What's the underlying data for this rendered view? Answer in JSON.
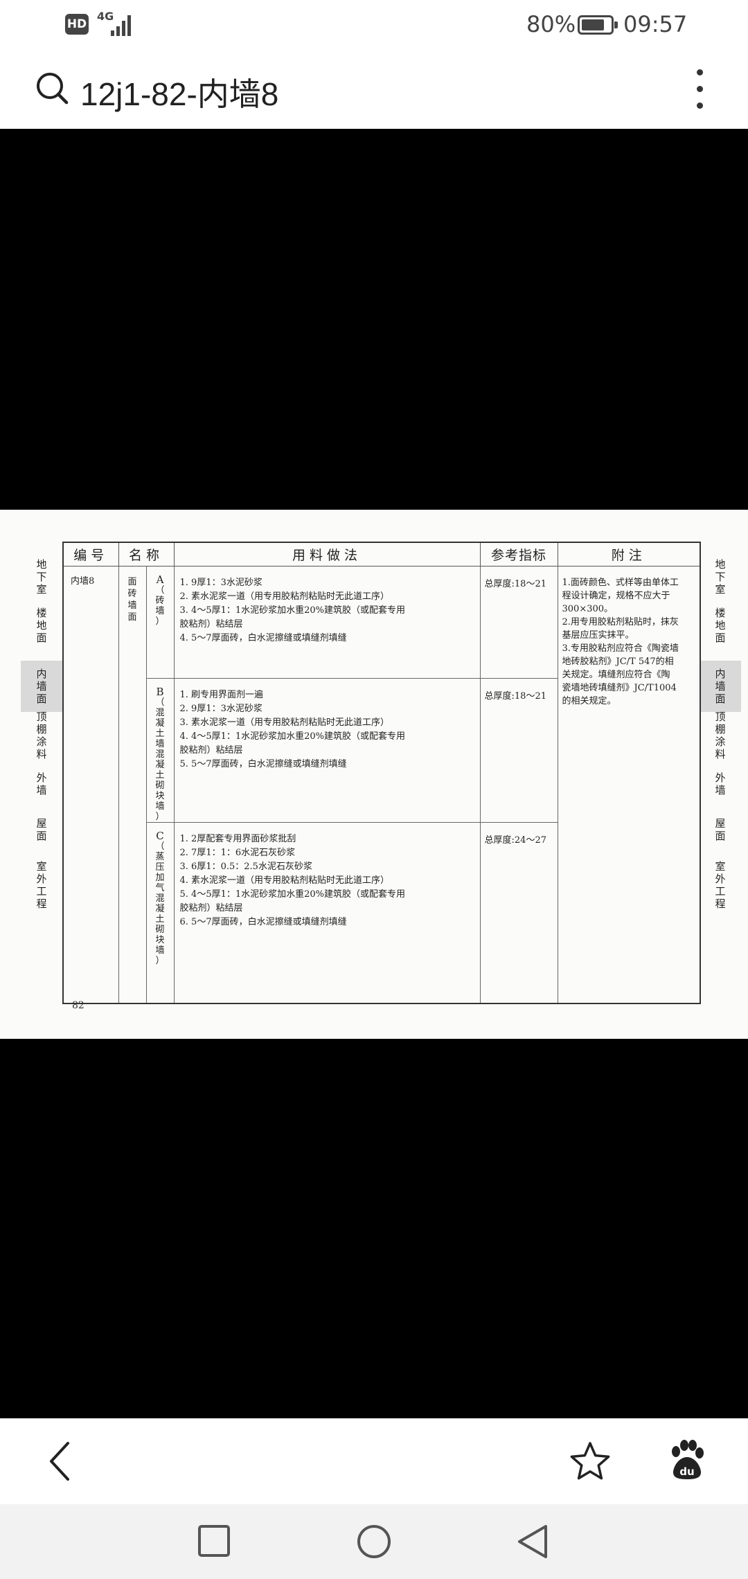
{
  "status_bar": {
    "hd": "HD",
    "network": "4G",
    "battery_percent": "80%",
    "battery_level": 0.8,
    "time": "09:57"
  },
  "search": {
    "query": "12j1-82-内墙8"
  },
  "icons": {
    "search": "search-icon",
    "more": "more-vert-icon",
    "back": "chevron-left-icon",
    "favorite": "star-icon",
    "baidu": "baidu-paw-icon",
    "recents": "square-nav-icon",
    "home": "circle-nav-icon",
    "nav_back": "triangle-back-nav-icon"
  },
  "document": {
    "left_tabs": [
      "地下室",
      "楼地面",
      "内墙面",
      "顶棚涂料",
      "外墙",
      "屋面",
      "室外工程"
    ],
    "right_tabs": [
      "地下室",
      "楼地面",
      "内墙面",
      "顶棚涂料",
      "外墙",
      "屋面",
      "室外工程"
    ],
    "active_tab": "内墙面",
    "headers": {
      "code": "编号",
      "name": "名称",
      "method": "用料做法",
      "ref": "参考指标",
      "notes": "附注"
    },
    "code": "内墙8",
    "name": "面砖墙面",
    "variants": [
      {
        "letter": "A",
        "wall": "（砖墙）",
        "ref": "总厚度:18～21",
        "steps": [
          "1.  9厚1：3水泥砂浆",
          "2.  素水泥浆一道（用专用胶粘剂粘贴时无此道工序）",
          "3.  4～5厚1：1水泥砂浆加水重20%建筑胶（或配套专用",
          "      胶粘剂）粘结层",
          "4.  5～7厚面砖，白水泥擦缝或填缝剂填缝"
        ]
      },
      {
        "letter": "B",
        "wall": "（混凝土墙、混凝土砌块墙）",
        "ref": "总厚度:18～21",
        "steps": [
          "1.  刷专用界面剂一遍",
          "2.  9厚1：3水泥砂浆",
          "3.  素水泥浆一道（用专用胶粘剂粘贴时无此道工序）",
          "4.  4～5厚1：1水泥砂浆加水重20%建筑胶（或配套专用",
          "      胶粘剂）粘结层",
          "5.  5～7厚面砖，白水泥擦缝或填缝剂填缝"
        ]
      },
      {
        "letter": "C",
        "wall": "（蒸压加气混凝土砌块墙）",
        "ref": "总厚度:24～27",
        "steps": [
          "1.  2厚配套专用界面砂浆批刮",
          "2.  7厚1：1：6水泥石灰砂浆",
          "3.  6厚1：0.5：2.5水泥石灰砂浆",
          "4.  素水泥浆一道（用专用胶粘剂粘贴时无此道工序）",
          "5.  4～5厚1：1水泥砂浆加水重20%建筑胶（或配套专用",
          "      胶粘剂）粘结层",
          "6.  5～7厚面砖，白水泥擦缝或填缝剂填缝"
        ]
      }
    ],
    "notes": [
      "1.面砖颜色、式样等由单体工",
      "   程设计确定，规格不应大于",
      "   300×300。",
      "2.用专用胶粘剂粘贴时，抹灰",
      "   基层应压实抹平。",
      "3.专用胶粘剂应符合《陶瓷墙",
      "   地砖胶粘剂》JC/T 547的相",
      "   关规定。填缝剂应符合《陶",
      "   瓷墙地砖填缝剂》JC/T1004",
      "   的相关规定。"
    ],
    "page_number": "82"
  }
}
